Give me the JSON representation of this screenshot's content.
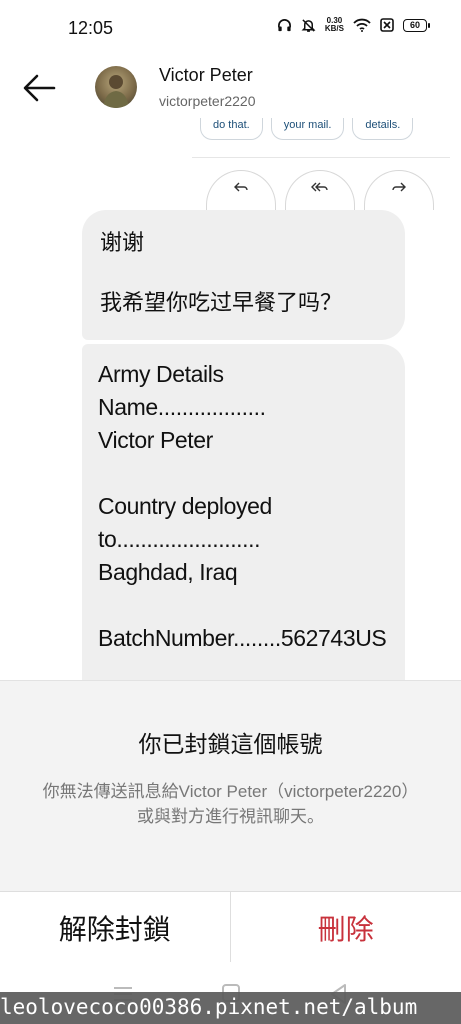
{
  "status_bar": {
    "time": "12:05",
    "net_speed_value": "0.30",
    "net_speed_unit": "KB/S",
    "battery": "60",
    "icons": [
      "headphones-icon",
      "bell-off-icon",
      "wifi-icon",
      "sim-off-icon",
      "battery-icon"
    ]
  },
  "header": {
    "contact_name": "Victor Peter",
    "contact_handle": "victorpeter2220"
  },
  "thread": {
    "suggested_chips": [
      "do that.",
      "your mail.",
      "details."
    ],
    "reply_icons": [
      "reply-icon",
      "reply-all-icon",
      "forward-icon"
    ],
    "bubble_1": {
      "line_1": "谢谢",
      "line_2": "我希望你吃过早餐了吗？"
    },
    "bubble_2": {
      "line_1": "Army Details",
      "line_2": "Name..................",
      "line_3": "Victor Peter",
      "line_4": "Country deployed",
      "line_5": "to........................",
      "line_6": "Baghdad, Iraq",
      "line_7": "BatchNumber........562743US"
    }
  },
  "blocked_sheet": {
    "title": "你已封鎖這個帳號",
    "body": "你無法傳送訊息給Victor Peter（victorpeter2220）或與對方進行視訊聊天。",
    "unblock_label": "解除封鎖",
    "delete_label": "刪除"
  },
  "watermark": "leolovecoco00386.pixnet.net/album"
}
